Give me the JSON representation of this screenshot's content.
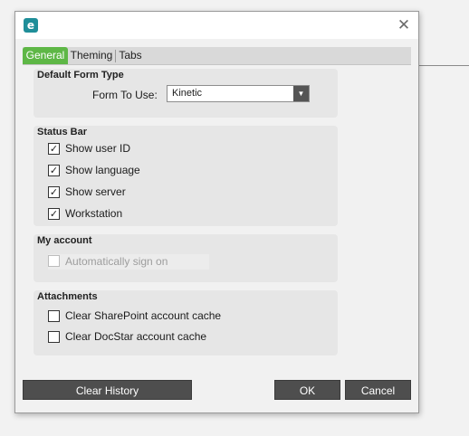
{
  "dialog": {
    "app_icon": "e",
    "close_icon": "✕"
  },
  "tabs": [
    {
      "label": "General",
      "active": true
    },
    {
      "label": "Theming",
      "active": false
    },
    {
      "label": "Tabs",
      "active": false
    }
  ],
  "default_form_type": {
    "title": "Default Form Type",
    "form_label": "Form To Use:",
    "form_value": "Kinetic"
  },
  "status_bar": {
    "title": "Status Bar",
    "items": [
      {
        "label": "Show user ID",
        "checked": true
      },
      {
        "label": "Show language",
        "checked": true
      },
      {
        "label": "Show server",
        "checked": true
      },
      {
        "label": "Workstation",
        "checked": true
      }
    ]
  },
  "my_account": {
    "title": "My account",
    "auto_sign_on": {
      "label": "Automatically sign on",
      "checked": false,
      "disabled": true
    }
  },
  "attachments": {
    "title": "Attachments",
    "items": [
      {
        "label": "Clear SharePoint account cache",
        "checked": false
      },
      {
        "label": "Clear DocStar account cache",
        "checked": false
      }
    ]
  },
  "buttons": {
    "clear_history": "Clear History",
    "ok": "OK",
    "cancel": "Cancel"
  },
  "colors": {
    "active_tab": "#5eb746",
    "app_icon": "#1f8e99",
    "button_bg": "#4e4e4e"
  }
}
